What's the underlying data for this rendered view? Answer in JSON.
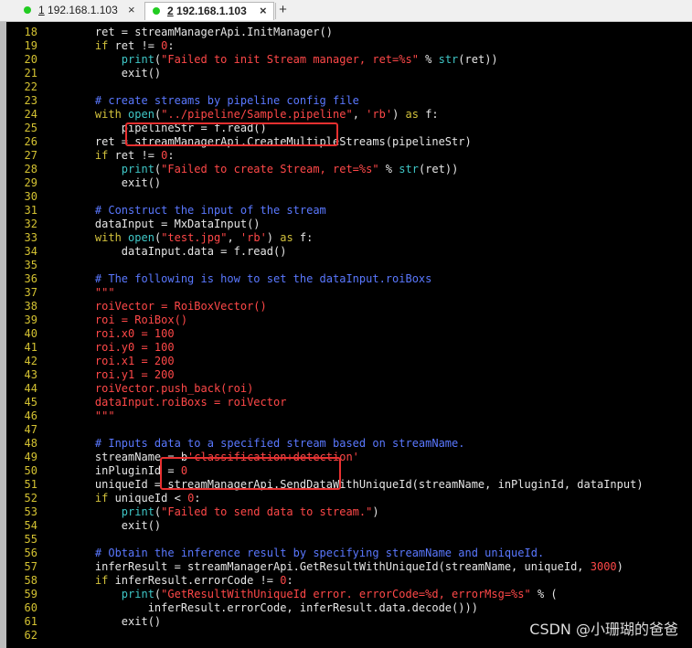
{
  "tabs": [
    {
      "number": "1",
      "title": "192.168.1.103",
      "status_color": "#22cc22",
      "active": false
    },
    {
      "number": "2",
      "title": "192.168.1.103",
      "status_color": "#22cc22",
      "active": true
    }
  ],
  "tab_close_icon": "close-icon",
  "new_tab_label": "+",
  "watermark": "CSDN @小珊瑚的爸爸",
  "colors": {
    "keyword": "#d2c13c",
    "string": "#ff4848",
    "comment": "#5a78ff",
    "builtin": "#3fc7c7",
    "text": "#e6e6e6",
    "line_number": "#d4c232",
    "highlight_box": "#e83030"
  },
  "code_lines": [
    {
      "n": "18",
      "t": [
        [
          "    ret = streamManagerApi.InitManager()",
          ""
        ]
      ]
    },
    {
      "n": "19",
      "t": [
        [
          "    ",
          ""
        ],
        [
          "if",
          "kw"
        ],
        [
          " ret != ",
          ""
        ],
        [
          "0",
          "n"
        ],
        [
          ":",
          ""
        ]
      ]
    },
    {
      "n": "20",
      "t": [
        [
          "        ",
          ""
        ],
        [
          "print",
          "b"
        ],
        [
          "(",
          ""
        ],
        [
          "\"Failed to init Stream manager, ret=%s\"",
          "s"
        ],
        [
          " % ",
          ""
        ],
        [
          "str",
          "b"
        ],
        [
          "(ret))",
          ""
        ]
      ]
    },
    {
      "n": "21",
      "t": [
        [
          "        exit()",
          ""
        ]
      ]
    },
    {
      "n": "22",
      "t": []
    },
    {
      "n": "23",
      "t": [
        [
          "    ",
          ""
        ],
        [
          "# create streams by pipeline config file",
          "c"
        ]
      ]
    },
    {
      "n": "24",
      "t": [
        [
          "    ",
          ""
        ],
        [
          "with",
          "kw"
        ],
        [
          " ",
          ""
        ],
        [
          "open",
          "b"
        ],
        [
          "(",
          ""
        ],
        [
          "\"../pipeline/Sample.pipeline\"",
          "s"
        ],
        [
          ", ",
          ""
        ],
        [
          "'rb'",
          "s"
        ],
        [
          ") ",
          ""
        ],
        [
          "as",
          "kw"
        ],
        [
          " f:",
          ""
        ]
      ]
    },
    {
      "n": "25",
      "t": [
        [
          "        pipelineStr = f.read()",
          ""
        ]
      ]
    },
    {
      "n": "26",
      "t": [
        [
          "    ret = streamManagerApi.CreateMultipleStreams(pipelineStr)",
          ""
        ]
      ]
    },
    {
      "n": "27",
      "t": [
        [
          "    ",
          ""
        ],
        [
          "if",
          "kw"
        ],
        [
          " ret != ",
          ""
        ],
        [
          "0",
          "n"
        ],
        [
          ":",
          ""
        ]
      ]
    },
    {
      "n": "28",
      "t": [
        [
          "        ",
          ""
        ],
        [
          "print",
          "b"
        ],
        [
          "(",
          ""
        ],
        [
          "\"Failed to create Stream, ret=%s\"",
          "s"
        ],
        [
          " % ",
          ""
        ],
        [
          "str",
          "b"
        ],
        [
          "(ret))",
          ""
        ]
      ]
    },
    {
      "n": "29",
      "t": [
        [
          "        exit()",
          ""
        ]
      ]
    },
    {
      "n": "30",
      "t": []
    },
    {
      "n": "31",
      "t": [
        [
          "    ",
          ""
        ],
        [
          "# Construct the input of the stream",
          "c"
        ]
      ]
    },
    {
      "n": "32",
      "t": [
        [
          "    dataInput = MxDataInput()",
          ""
        ]
      ]
    },
    {
      "n": "33",
      "t": [
        [
          "    ",
          ""
        ],
        [
          "with",
          "kw"
        ],
        [
          " ",
          ""
        ],
        [
          "open",
          "b"
        ],
        [
          "(",
          ""
        ],
        [
          "\"test.jpg\"",
          "s"
        ],
        [
          ", ",
          ""
        ],
        [
          "'rb'",
          "s"
        ],
        [
          ") ",
          ""
        ],
        [
          "as",
          "kw"
        ],
        [
          " f:",
          ""
        ]
      ]
    },
    {
      "n": "34",
      "t": [
        [
          "        dataInput.data = f.read()",
          ""
        ]
      ]
    },
    {
      "n": "35",
      "t": []
    },
    {
      "n": "36",
      "t": [
        [
          "    ",
          ""
        ],
        [
          "# The following is how to set the dataInput.roiBoxs",
          "c"
        ]
      ]
    },
    {
      "n": "37",
      "t": [
        [
          "    ",
          ""
        ],
        [
          "\"\"\"",
          "s"
        ]
      ]
    },
    {
      "n": "38",
      "t": [
        [
          "    ",
          ""
        ],
        [
          "roiVector = RoiBoxVector()",
          "s"
        ]
      ]
    },
    {
      "n": "39",
      "t": [
        [
          "    ",
          ""
        ],
        [
          "roi = RoiBox()",
          "s"
        ]
      ]
    },
    {
      "n": "40",
      "t": [
        [
          "    ",
          ""
        ],
        [
          "roi.x0 = 100",
          "s"
        ]
      ]
    },
    {
      "n": "41",
      "t": [
        [
          "    ",
          ""
        ],
        [
          "roi.y0 = 100",
          "s"
        ]
      ]
    },
    {
      "n": "42",
      "t": [
        [
          "    ",
          ""
        ],
        [
          "roi.x1 = 200",
          "s"
        ]
      ]
    },
    {
      "n": "43",
      "t": [
        [
          "    ",
          ""
        ],
        [
          "roi.y1 = 200",
          "s"
        ]
      ]
    },
    {
      "n": "44",
      "t": [
        [
          "    ",
          ""
        ],
        [
          "roiVector.push_back(roi)",
          "s"
        ]
      ]
    },
    {
      "n": "45",
      "t": [
        [
          "    ",
          ""
        ],
        [
          "dataInput.roiBoxs = roiVector",
          "s"
        ]
      ]
    },
    {
      "n": "46",
      "t": [
        [
          "    ",
          ""
        ],
        [
          "\"\"\"",
          "s"
        ]
      ]
    },
    {
      "n": "47",
      "t": []
    },
    {
      "n": "48",
      "t": [
        [
          "    ",
          ""
        ],
        [
          "# Inputs data to a specified stream based on streamName.",
          "c"
        ]
      ]
    },
    {
      "n": "49",
      "t": [
        [
          "    streamName = b",
          ""
        ],
        [
          "'classification+detection'",
          "s"
        ]
      ]
    },
    {
      "n": "50",
      "t": [
        [
          "    inPluginId = ",
          ""
        ],
        [
          "0",
          "n"
        ]
      ]
    },
    {
      "n": "51",
      "t": [
        [
          "    uniqueId = streamManagerApi.SendDataWithUniqueId(streamName, inPluginId, dataInput)",
          ""
        ]
      ]
    },
    {
      "n": "52",
      "t": [
        [
          "    ",
          ""
        ],
        [
          "if",
          "kw"
        ],
        [
          " uniqueId < ",
          ""
        ],
        [
          "0",
          "n"
        ],
        [
          ":",
          ""
        ]
      ]
    },
    {
      "n": "53",
      "t": [
        [
          "        ",
          ""
        ],
        [
          "print",
          "b"
        ],
        [
          "(",
          ""
        ],
        [
          "\"Failed to send data to stream.\"",
          "s"
        ],
        [
          ")",
          ""
        ]
      ]
    },
    {
      "n": "54",
      "t": [
        [
          "        exit()",
          ""
        ]
      ]
    },
    {
      "n": "55",
      "t": []
    },
    {
      "n": "56",
      "t": [
        [
          "    ",
          ""
        ],
        [
          "# Obtain the inference result by specifying streamName and uniqueId.",
          "c"
        ]
      ]
    },
    {
      "n": "57",
      "t": [
        [
          "    inferResult = streamManagerApi.GetResultWithUniqueId(streamName, uniqueId, ",
          ""
        ],
        [
          "3000",
          "n"
        ],
        [
          ")",
          ""
        ]
      ]
    },
    {
      "n": "58",
      "t": [
        [
          "    ",
          ""
        ],
        [
          "if",
          "kw"
        ],
        [
          " inferResult.errorCode != ",
          ""
        ],
        [
          "0",
          "n"
        ],
        [
          ":",
          ""
        ]
      ]
    },
    {
      "n": "59",
      "t": [
        [
          "        ",
          ""
        ],
        [
          "print",
          "b"
        ],
        [
          "(",
          ""
        ],
        [
          "\"GetResultWithUniqueId error. errorCode=%d, errorMsg=%s\"",
          "s"
        ],
        [
          " % (",
          ""
        ]
      ]
    },
    {
      "n": "60",
      "t": [
        [
          "            inferResult.errorCode, inferResult.data.decode()))",
          ""
        ]
      ]
    },
    {
      "n": "61",
      "t": [
        [
          "        exit()",
          ""
        ]
      ]
    },
    {
      "n": "62",
      "t": []
    }
  ]
}
